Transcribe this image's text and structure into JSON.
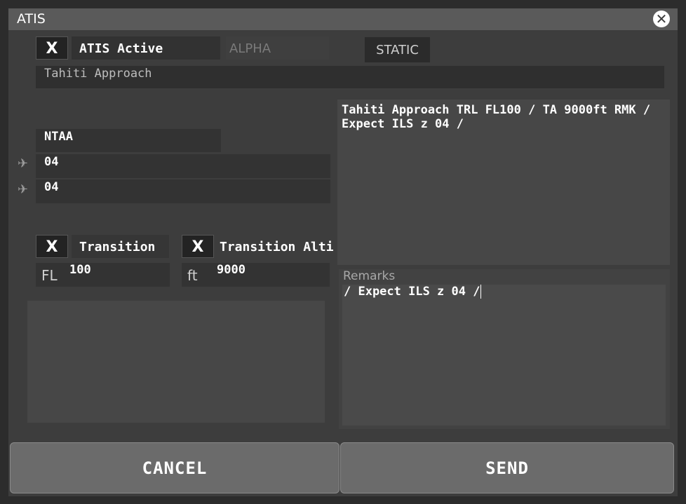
{
  "window": {
    "title": "ATIS"
  },
  "atis": {
    "active_check": "X",
    "active_label": "ATIS Active",
    "letter": "ALPHA",
    "mode_button": "STATIC",
    "station_name": "Tahiti Approach",
    "airport": "NTAA",
    "arrival_runway": "04",
    "departure_runway": "04"
  },
  "transition": {
    "level_check": "X",
    "level_label": "Transition",
    "level_unit": "FL",
    "level_value": "100",
    "alt_check": "X",
    "alt_label": "Transition Alti",
    "alt_unit": "ft",
    "alt_value": "9000"
  },
  "preview": {
    "text": "Tahiti Approach TRL FL100 / TA 9000ft RMK / Expect ILS z 04 /"
  },
  "remarks": {
    "label": "Remarks",
    "value": "/ Expect ILS z 04 /"
  },
  "footer": {
    "cancel_label": "CANCEL",
    "send_label": "SEND"
  }
}
